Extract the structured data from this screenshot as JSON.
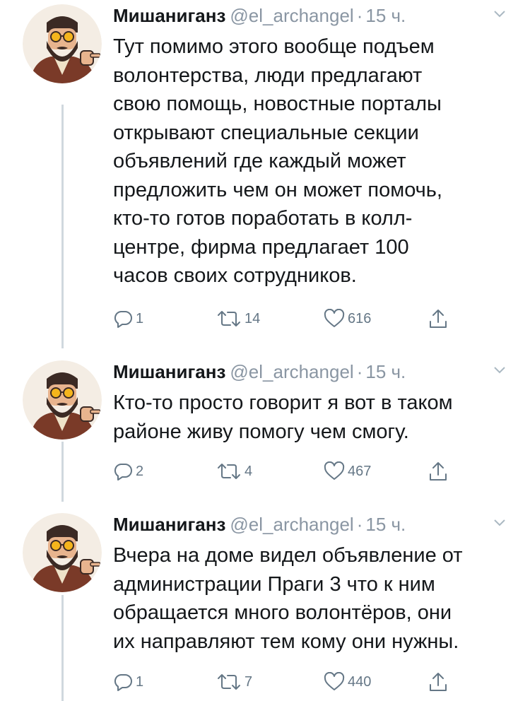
{
  "tweets": [
    {
      "name": "Мишаниганз",
      "handle": "@el_archangel",
      "dot": "·",
      "time": "15 ч.",
      "text": "Тут помимо этого вообще подъем\nволонтерства, люди предлагают\nсвою помощь, новостные порталы\nоткрывают специальные секции\nобъявлений где каждый может\nпредложить чем он может помочь,\nкто-то готов поработать в колл-\nцентре, фирма предлагает 100\nчасов своих сотрудников.",
      "replies": "1",
      "retweets": "14",
      "likes": "616"
    },
    {
      "name": "Мишаниганз",
      "handle": "@el_archangel",
      "dot": "·",
      "time": "15 ч.",
      "text": "Кто-то просто говорит я вот в таком\nрайоне живу помогу чем смогу.",
      "replies": "2",
      "retweets": "4",
      "likes": "467"
    },
    {
      "name": "Мишаниганз",
      "handle": "@el_archangel",
      "dot": "·",
      "time": "15 ч.",
      "text": "Вчера на доме видел объявление от\nадминистрации Праги 3 что к ним\nобращается много волонтёров, они\nих направляют тем кому они нужны.",
      "replies": "1",
      "retweets": "7",
      "likes": "440"
    }
  ],
  "colors": {
    "text": "#14171a",
    "secondary": "#8a96a3",
    "icon": "#657786",
    "thread_line": "#d0d8de"
  },
  "icons": [
    "reply-icon",
    "retweet-icon",
    "like-icon",
    "share-icon",
    "chevron-down-icon",
    "avatar-illustration"
  ]
}
